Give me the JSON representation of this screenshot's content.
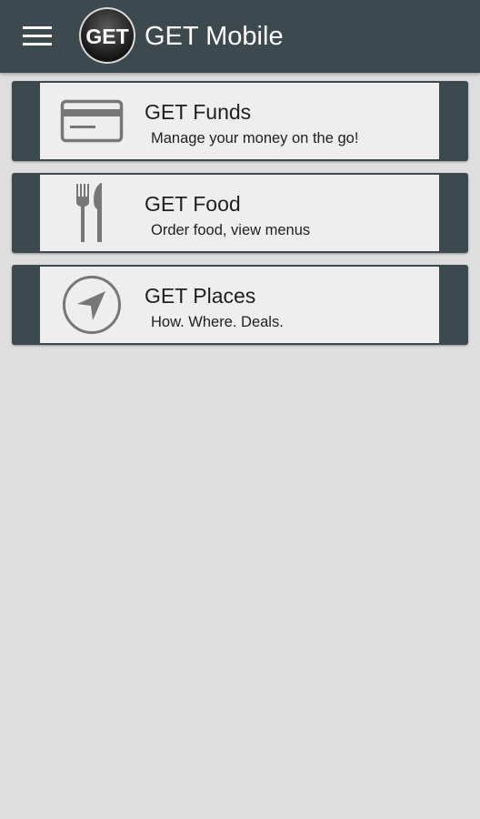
{
  "app": {
    "title": "GET Mobile",
    "logo_text": "GET"
  },
  "colors": {
    "appbar": "#3c4a4f",
    "background": "#dedede",
    "card_face": "#eeeeee",
    "icon_gray": "#777777"
  },
  "cards": [
    {
      "title": "GET Funds",
      "subtitle": "Manage your money on the go!",
      "icon": "credit-card-icon"
    },
    {
      "title": "GET Food",
      "subtitle": "Order food, view menus",
      "icon": "fork-knife-icon"
    },
    {
      "title": "GET Places",
      "subtitle": "How. Where. Deals.",
      "icon": "navigation-compass-icon"
    }
  ]
}
